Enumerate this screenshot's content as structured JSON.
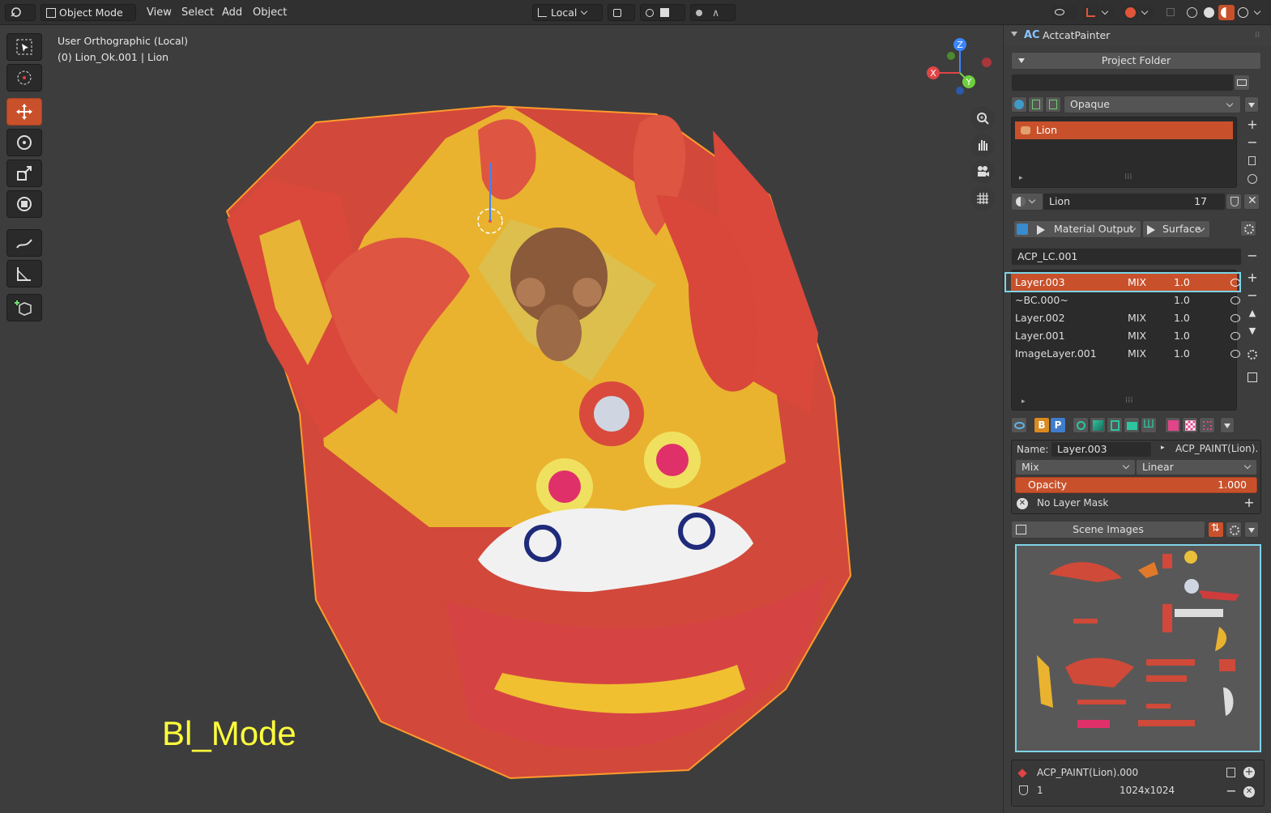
{
  "header": {
    "mode_label": "Object Mode",
    "menu": [
      "View",
      "Select",
      "Add",
      "Object"
    ],
    "transform_orientation": "Local"
  },
  "viewport": {
    "view_name": "User Orthographic (Local)",
    "object_info": "(0) Lion_Ok.001 | Lion",
    "overlay_text": "Bl_Mode",
    "gizmo_axes": {
      "x": "X",
      "y": "Y",
      "z": "Z"
    },
    "tools": [
      "select-box-icon",
      "cursor-icon",
      "move-icon",
      "rotate-icon",
      "scale-icon",
      "transform-icon",
      "annotate-icon",
      "measure-icon",
      "add-cube-icon"
    ],
    "nav": [
      "zoom-icon",
      "pan-hand-icon",
      "camera-icon",
      "grid-icon"
    ]
  },
  "panel": {
    "addon_title": "ActcatPainter",
    "project_folder_label": "Project Folder",
    "project_path": "",
    "blend_mode": "Opaque",
    "material_list": [
      "Lion"
    ],
    "material_name": "Lion",
    "material_users": "17",
    "output_node": "Material Output",
    "output_socket": "Surface",
    "layer_collection": "ACP_LC.001",
    "layers": [
      {
        "name": "Layer.003",
        "blend": "MIX",
        "opacity": "1.0",
        "selected": true
      },
      {
        "name": "~BC.000~",
        "blend": "",
        "opacity": "1.0",
        "selected": false
      },
      {
        "name": "Layer.002",
        "blend": "MIX",
        "opacity": "1.0",
        "selected": false
      },
      {
        "name": "Layer.001",
        "blend": "MIX",
        "opacity": "1.0",
        "selected": false
      },
      {
        "name": "ImageLayer.001",
        "blend": "MIX",
        "opacity": "1.0",
        "selected": false
      }
    ],
    "tab_letters": {
      "b": "B",
      "p": "P"
    },
    "name_label": "Name:",
    "layer_name_value": "Layer.003",
    "image_link": "ACP_PAINT(Lion).",
    "blend_select": "Mix",
    "interp_select": "Linear",
    "opacity_label": "Opacity",
    "opacity_value": "1.000",
    "mask_label": "No Layer Mask",
    "scene_images_label": "Scene Images",
    "image_name": "ACP_PAINT(Lion).000",
    "image_users": "1",
    "image_size": "1024x1024"
  },
  "colors": {
    "accent": "#c8512b",
    "selection_outline": "#7fd3e6",
    "overlay_text": "#ffff3c"
  }
}
